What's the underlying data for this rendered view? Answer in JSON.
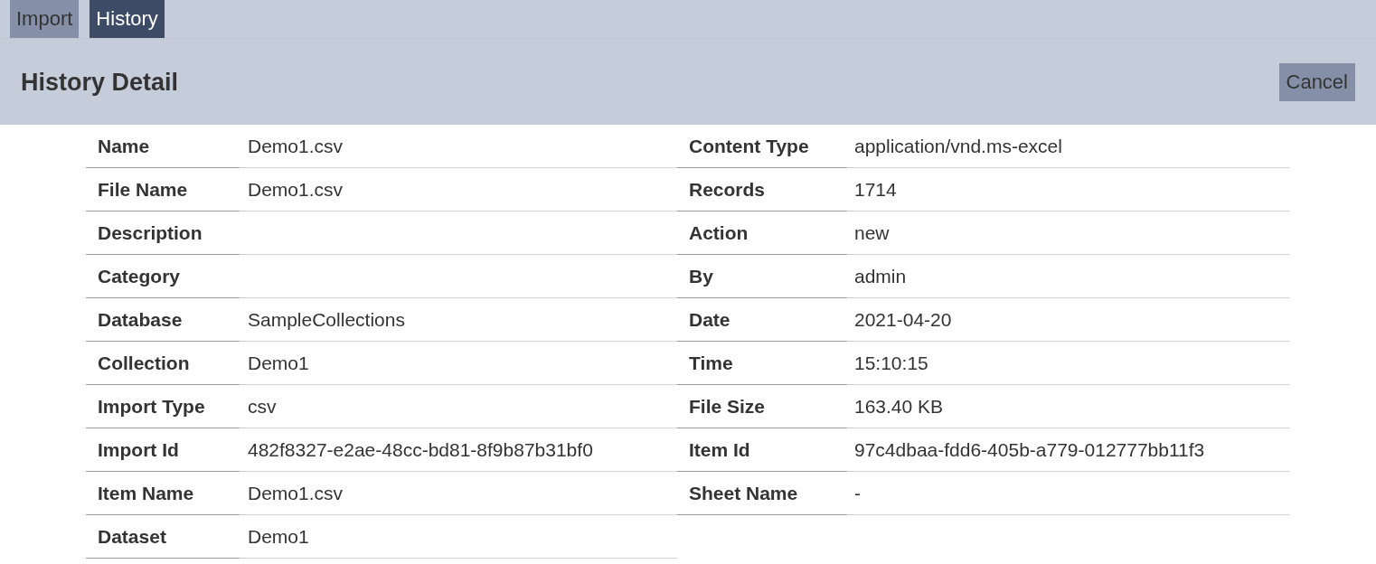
{
  "tabs": [
    {
      "label": "Import",
      "selected": false
    },
    {
      "label": "History",
      "selected": true
    }
  ],
  "header": {
    "title": "History Detail",
    "cancel_button": "Cancel"
  },
  "rows": [
    {
      "fields": [
        {
          "label": "Name",
          "value": "Demo1.csv"
        },
        {
          "label": "Content Type",
          "value": "application/vnd.ms-excel"
        }
      ]
    },
    {
      "fields": [
        {
          "label": "File Name",
          "value": "Demo1.csv"
        },
        {
          "label": "Records",
          "value": "1714"
        }
      ]
    },
    {
      "fields": [
        {
          "label": "Description"
        },
        {
          "label": "Action",
          "value": "new"
        }
      ]
    },
    {
      "fields": [
        {
          "label": "Category"
        },
        {
          "label": "By",
          "value": "admin"
        }
      ]
    },
    {
      "fields": [
        {
          "label": "Database",
          "value": "SampleCollections"
        },
        {
          "label": "Date",
          "value": "2021-04-20"
        }
      ]
    },
    {
      "fields": [
        {
          "label": "Collection",
          "value": "Demo1"
        },
        {
          "label": "Time",
          "value": "15:10:15"
        }
      ]
    },
    {
      "fields": [
        {
          "label": "Import Type",
          "value": "csv"
        },
        {
          "label": "File Size",
          "value": "163.40 KB"
        }
      ]
    },
    {
      "fields": [
        {
          "label": "Import Id",
          "value": "482f8327-e2ae-48cc-bd81-8f9b87b31bf0"
        },
        {
          "label": "Item Id",
          "value": "97c4dbaa-fdd6-405b-a779-012777bb11f3"
        }
      ]
    },
    {
      "fields": [
        {
          "label": "Item Name",
          "value": "Demo1.csv"
        },
        {
          "label": "Sheet Name",
          "value": "-"
        }
      ]
    },
    {
      "fields": [
        {
          "label": "Dataset",
          "value": "Demo1"
        }
      ]
    }
  ]
}
